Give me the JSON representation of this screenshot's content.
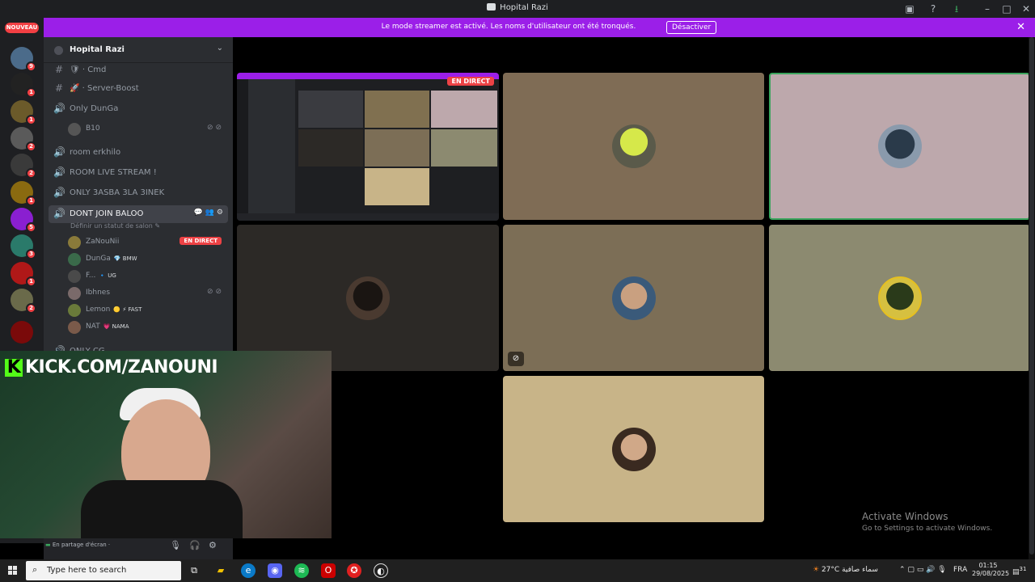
{
  "window": {
    "title": "Hopital Razi"
  },
  "banner": {
    "message": "Le mode streamer est activé. Les noms d'utilisateur ont été tronqués.",
    "button": "Désactiver"
  },
  "rail": {
    "nouveau": "NOUVEAU",
    "servers": [
      {
        "badge": "9",
        "color": "#4b6b8a"
      },
      {
        "badge": "1",
        "color": "#222222"
      },
      {
        "badge": "1",
        "color": "#6b5a2a"
      },
      {
        "badge": "2",
        "color": "#5a5a5a"
      },
      {
        "badge": "2",
        "color": "#3a3a3a"
      },
      {
        "badge": "1",
        "color": "#8a6a10"
      },
      {
        "badge": "5",
        "color": "#8a1fd0"
      },
      {
        "badge": "3",
        "color": "#2a7a6a"
      },
      {
        "badge": "1",
        "color": "#b01818"
      },
      {
        "badge": "2",
        "color": "#6a6a4a"
      },
      {
        "badge": "",
        "color": "#7a0a0a"
      }
    ]
  },
  "sidebar": {
    "server_name": "Hopital Razi",
    "channels": [
      {
        "type": "text",
        "label": "🛡 · Cmd"
      },
      {
        "type": "text",
        "label": "🚀 · Server-Boost"
      },
      {
        "type": "voice",
        "label": "Only DunGa"
      },
      {
        "type": "voice",
        "label": "room erkhilo"
      },
      {
        "type": "voice",
        "label": "ROOM LIVE STREAM !"
      },
      {
        "type": "voice",
        "label": "ONLY 3ASBA 3LA 3INEK"
      },
      {
        "type": "voice",
        "label": "DONT JOIN BALOO"
      }
    ],
    "only_dunga_user": "B10",
    "salon_status": "Définir un statut de salon ✎",
    "voice_users": [
      {
        "name": "ZaNouNii",
        "tag": "",
        "live": "EN DIRECT"
      },
      {
        "name": "DunGa",
        "tag": "💎 BMW",
        "live": ""
      },
      {
        "name": "F...",
        "tag": "🔹 UG",
        "live": ""
      },
      {
        "name": "Ibhnes",
        "tag": "",
        "live": ""
      },
      {
        "name": "Lemon",
        "tag": "🟡 ⚡ FAST",
        "live": ""
      },
      {
        "name": "NAT",
        "tag": "💗 NAMA",
        "live": ""
      }
    ],
    "next_channel": "ONLY CG",
    "user_status": "En partage d'écran ·"
  },
  "tiles": {
    "live_label": "EN DIRECT"
  },
  "webcam": {
    "overlay_text": "KICK.COM/ZANOUNI",
    "logo_letter": "K"
  },
  "watermark": {
    "title": "Activate Windows",
    "subtitle": "Go to Settings to activate Windows."
  },
  "taskbar": {
    "search_placeholder": "Type here to search",
    "weather_temp": "27°C",
    "weather_text": "سماء صافية",
    "language": "FRA",
    "time": "01:15",
    "date": "29/08/2025",
    "notif_count": "31"
  },
  "colors": {
    "accent_banner": "#9b1fe8",
    "live_red": "#ed4245",
    "speaking_green": "#3ba55d",
    "kick_green": "#53fc18"
  }
}
